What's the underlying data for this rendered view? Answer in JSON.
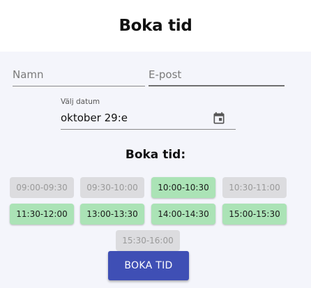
{
  "header": {
    "title": "Boka tid"
  },
  "form": {
    "name": {
      "placeholder": "Namn",
      "value": ""
    },
    "email": {
      "placeholder": "E-post",
      "value": ""
    },
    "date": {
      "label": "Välj datum",
      "value": "oktober 29:e",
      "icon": "calendar-icon"
    }
  },
  "slots_section": {
    "title": "Boka tid:",
    "slots": [
      {
        "label": "09:00-09:30",
        "available": false
      },
      {
        "label": "09:30-10:00",
        "available": false
      },
      {
        "label": "10:00-10:30",
        "available": true
      },
      {
        "label": "10:30-11:00",
        "available": false
      },
      {
        "label": "11:30-12:00",
        "available": true
      },
      {
        "label": "13:00-13:30",
        "available": true
      },
      {
        "label": "14:00-14:30",
        "available": true
      },
      {
        "label": "15:00-15:30",
        "available": true
      },
      {
        "label": "15:30-16:00",
        "available": false
      }
    ]
  },
  "submit": {
    "label": "BOKA TID"
  },
  "colors": {
    "available": "#abe3b6",
    "disabled": "#dcdcdf",
    "primary": "#3f4fb5",
    "panel": "#f4f5fb"
  }
}
